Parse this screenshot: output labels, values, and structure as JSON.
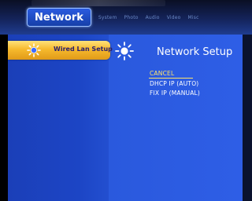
{
  "tabs": {
    "active": "Network",
    "items": [
      "System",
      "Photo",
      "Audio",
      "Video",
      "Misc"
    ]
  },
  "sidebar": {
    "items": [
      {
        "label": "Wired Lan Setup",
        "icon": "sun-icon",
        "selected": true
      }
    ]
  },
  "setup": {
    "title": "Network Setup",
    "icon": "sun-icon",
    "options": [
      "CANCEL",
      "DHCP IP (AUTO)",
      "FIX IP (MANUAL)"
    ],
    "selected_option": "CANCEL"
  },
  "colors": {
    "sidebar_panel": "#1c45c5",
    "content_panel": "#2e5ee6",
    "highlight": "#f6b92d",
    "selected_option_text": "#ffe46a",
    "tab_active": "#2a5be0"
  }
}
